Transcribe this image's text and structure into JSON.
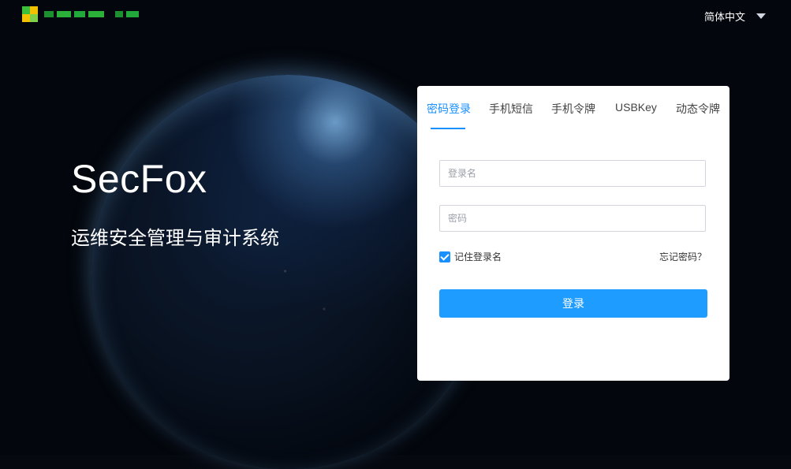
{
  "header": {
    "language_label": "简体中文",
    "logo_colors": [
      "#f2c200",
      "#3cbf3a",
      "#1c8f2e",
      "#7fd14a"
    ]
  },
  "hero": {
    "title": "SecFox",
    "subtitle": "运维安全管理与审计系统"
  },
  "login": {
    "tabs": [
      {
        "label": "密码登录",
        "active": true
      },
      {
        "label": "手机短信",
        "active": false
      },
      {
        "label": "手机令牌",
        "active": false
      },
      {
        "label": "USBKey",
        "active": false
      },
      {
        "label": "动态令牌",
        "active": false
      }
    ],
    "username": {
      "placeholder": "登录名",
      "value": ""
    },
    "password": {
      "placeholder": "密码",
      "value": ""
    },
    "remember": {
      "label": "记住登录名",
      "checked": true
    },
    "forgot_label": "忘记密码？",
    "submit_label": "登录"
  },
  "colors": {
    "accent": "#1890ff",
    "button": "#1e9cff"
  }
}
